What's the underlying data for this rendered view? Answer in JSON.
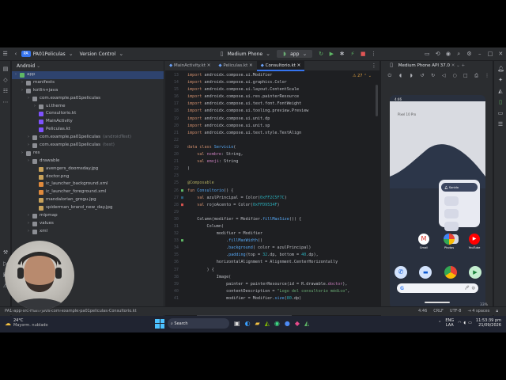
{
  "topbar": {
    "project_badge": "PA",
    "project_name": "PA01Peliculas",
    "vcs": "Version Control",
    "device": "Medium Phone",
    "run_config": "app"
  },
  "project_panel": {
    "title": "Android",
    "tree": [
      {
        "label": "app",
        "note": "",
        "depth": 0,
        "selected": true,
        "kind": "folder-green"
      },
      {
        "label": "manifests",
        "note": "",
        "depth": 1,
        "kind": "folder"
      },
      {
        "label": "kotlin+java",
        "note": "",
        "depth": 1,
        "kind": "folder"
      },
      {
        "label": "com.example.pa01peliculas",
        "note": "",
        "depth": 2,
        "kind": "package"
      },
      {
        "label": "ui.theme",
        "note": "",
        "depth": 3,
        "kind": "package"
      },
      {
        "label": "Consultorio.kt",
        "note": "",
        "depth": 3,
        "kind": "kotlin"
      },
      {
        "label": "MainActivity",
        "note": "",
        "depth": 3,
        "kind": "kotlin"
      },
      {
        "label": "Peliculas.kt",
        "note": "",
        "depth": 3,
        "kind": "kotlin"
      },
      {
        "label": "com.example.pa01peliculas",
        "note": "(androidTest)",
        "depth": 2,
        "kind": "package"
      },
      {
        "label": "com.example.pa01peliculas",
        "note": "(test)",
        "depth": 2,
        "kind": "package"
      },
      {
        "label": "res",
        "note": "",
        "depth": 1,
        "kind": "folder"
      },
      {
        "label": "drawable",
        "note": "",
        "depth": 2,
        "kind": "folder"
      },
      {
        "label": "avengers_doomsday.jpg",
        "note": "",
        "depth": 3,
        "kind": "image"
      },
      {
        "label": "doctor.png",
        "note": "",
        "depth": 3,
        "kind": "image"
      },
      {
        "label": "ic_launcher_background.xml",
        "note": "",
        "depth": 3,
        "kind": "xml"
      },
      {
        "label": "ic_launcher_foreground.xml",
        "note": "",
        "depth": 3,
        "kind": "xml"
      },
      {
        "label": "mandalorian_grogu.jpg",
        "note": "",
        "depth": 3,
        "kind": "image"
      },
      {
        "label": "spiderman_brand_new_day.jpg",
        "note": "",
        "depth": 3,
        "kind": "image"
      },
      {
        "label": "mipmap",
        "note": "",
        "depth": 2,
        "kind": "folder"
      },
      {
        "label": "values",
        "note": "",
        "depth": 2,
        "kind": "folder"
      },
      {
        "label": "xml",
        "note": "",
        "depth": 2,
        "kind": "folder"
      }
    ]
  },
  "editor": {
    "tabs": [
      "MainActivity.kt",
      "Peliculas.kt",
      "Consultorio.kt"
    ],
    "active_tab": 2,
    "warnings": "27",
    "lines": [
      {
        "n": "13",
        "html": "<span class='kw'>import</span> androidx.compose.ui.Modifier"
      },
      {
        "n": "14",
        "html": "<span class='kw'>import</span> androidx.compose.ui.graphics.Color"
      },
      {
        "n": "15",
        "html": "<span class='kw'>import</span> androidx.compose.ui.layout.ContentScale"
      },
      {
        "n": "16",
        "html": "<span class='kw'>import</span> androidx.compose.ui.res.painterResource"
      },
      {
        "n": "17",
        "html": "<span class='kw'>import</span> androidx.compose.ui.text.font.FontWeight"
      },
      {
        "n": "18",
        "html": "<span class='kw'>import</span> androidx.compose.ui.tooling.preview.Preview"
      },
      {
        "n": "19",
        "html": "<span class='kw'>import</span> androidx.compose.ui.unit.dp"
      },
      {
        "n": "20",
        "html": "<span class='kw'>import</span> androidx.compose.ui.unit.sp"
      },
      {
        "n": "21",
        "html": "<span class='kw'>import</span> androidx.compose.ui.text.style.TextAlign"
      },
      {
        "n": "22",
        "html": ""
      },
      {
        "n": "19",
        "html": "<span class='kw'>data class</span> <span class='fn'>Servicio</span>("
      },
      {
        "n": "20",
        "html": "    <span class='kw'>val</span> <span class='pr'>nombre</span>: String,"
      },
      {
        "n": "21",
        "html": "    <span class='kw'>val</span> <span class='pr'>emoji</span>: String"
      },
      {
        "n": "22",
        "html": ")"
      },
      {
        "n": "23",
        "html": ""
      },
      {
        "n": "25",
        "html": "<span class='an'>@Composable</span>"
      },
      {
        "n": "26",
        "html": "<span class='kw'>fun</span> <span class='fn'>Consultorio</span>() {"
      },
      {
        "n": "27",
        "html": "    <span class='kw'>val</span> azulPrincipal = Color(<span class='num'>0xFF2C5F7C</span>)"
      },
      {
        "n": "28",
        "html": "    <span class='kw'>val</span> rojoAcento = Color(<span class='num'>0xFFD9534F</span>)"
      },
      {
        "n": "29",
        "html": ""
      },
      {
        "n": "30",
        "html": "    Column(modifier = Modifier.<span class='fn'>fillMaxSize</span>()) {"
      },
      {
        "n": "31",
        "html": "        Column("
      },
      {
        "n": "32",
        "html": "            modifier = Modifier"
      },
      {
        "n": "33",
        "html": "                .<span class='fn'>fillMaxWidth</span>()"
      },
      {
        "n": "34",
        "html": "                .<span class='fn'>background</span>( color = azulPrincipal)"
      },
      {
        "n": "35",
        "html": "                .<span class='fn'>padding</span>(top = <span class='num'>32</span>.dp, bottom = <span class='num'>40</span>.dp),"
      },
      {
        "n": "36",
        "html": "            horizontalAlignment = Alignment.CenterHorizontally"
      },
      {
        "n": "37",
        "html": "        ) {"
      },
      {
        "n": "38",
        "html": "            Image("
      },
      {
        "n": "39",
        "html": "                painter = painterResource(id = R.drawable.<span class='pr'>doctor</span>),"
      },
      {
        "n": "40",
        "html": "                contentDescription = <span class='str'>\"Logo del consultorio médico\"</span>,"
      },
      {
        "n": "41",
        "html": "                modifier = Modifier.<span class='fn'>size</span>(<span class='num'>80</span>.dp)"
      }
    ]
  },
  "emulator": {
    "title": "Medium Phone API 37.0",
    "status_time": "4:46",
    "search_hint": "Pixel 10 Pro",
    "qs_text": "Sonido",
    "apps_row1": [
      "Gmail",
      "Photos",
      "YouTube"
    ],
    "apps_row2": [
      "Phone",
      "Messages",
      "Chrome",
      "Play Store"
    ],
    "zoom": "33%"
  },
  "statusbar": {
    "breadcrumb": [
      "PA1",
      "app",
      "src",
      "main",
      "java",
      "com",
      "example",
      "pa01peliculas",
      "Consultorio.kt"
    ],
    "position": "4:46",
    "line_ending": "CRLF",
    "encoding": "UTF-8",
    "indent": "4 spaces"
  },
  "taskbar": {
    "weather_temp": "24°C",
    "weather_desc": "Mayorm. nublado",
    "search_placeholder": "Search",
    "lang": "ENG",
    "lang2": "LAA",
    "time": "11:53:39 pm",
    "date": "21/09/2026"
  }
}
